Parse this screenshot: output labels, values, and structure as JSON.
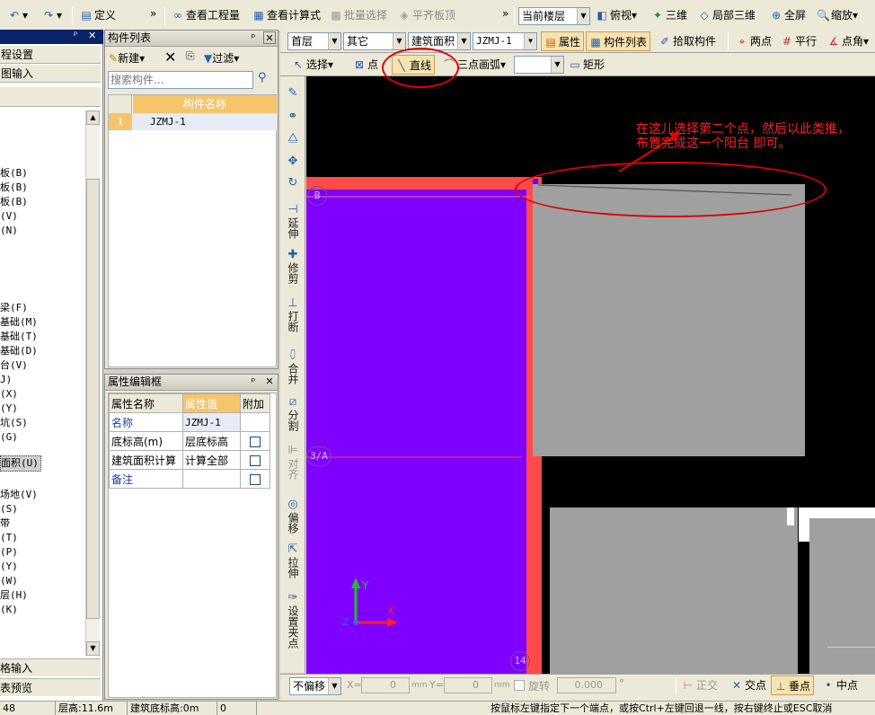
{
  "top_toolbar": {
    "undo_icon": "undo-icon",
    "redo_icon": "redo-icon",
    "define": "定义",
    "view_quantity": "查看工程量",
    "view_formula": "查看计算式",
    "batch_select": "批量选择",
    "flush_slab_top": "平齐板顶",
    "floor_combo": "当前楼层",
    "top_view": "俯视",
    "three_d": "三维",
    "local_3d": "局部三维",
    "fullscreen": "全屏",
    "zoom": "缩放"
  },
  "second_toolbar": {
    "floor": "首层",
    "category": "其它",
    "type": "建筑面积",
    "component": "JZMJ-1",
    "properties": "属性",
    "component_list": "构件列表",
    "pick_component": "拾取构件",
    "two_points": "两点",
    "parallel": "平行",
    "point_angle": "点角"
  },
  "draw_toolbar": {
    "select": "选择",
    "point": "点",
    "line": "直线",
    "arc": "三点画弧",
    "shape_combo": "",
    "rectangle": "矩形"
  },
  "left_panel": {
    "item1": "程设置",
    "item2": "图输入",
    "list": [
      "板(B)",
      "板(B)",
      "板(B)",
      "(V)",
      "(N)",
      "梁(F)",
      "基础(M)",
      "基础(T)",
      "基础(D)",
      "台(V)",
      "J)",
      "(X)",
      "(Y)",
      "坑(S)",
      "(G)",
      "面积(U)",
      "场地(V)",
      "(S)",
      "带",
      "(T)",
      "(P)",
      "(Y)",
      "(W)",
      "层(H)",
      "(K)"
    ],
    "selected_index": 15,
    "bottom1": "格输入",
    "bottom2": "表预览"
  },
  "component_list": {
    "title": "构件列表",
    "new": "新建",
    "filter": "过滤",
    "search_placeholder": "搜索构件...",
    "header": "构件名称",
    "rows": [
      {
        "num": "1",
        "name": "JZMJ-1"
      }
    ]
  },
  "property_panel": {
    "title": "属性编辑框",
    "headers": [
      "属性名称",
      "属性值",
      "附加"
    ],
    "rows": [
      {
        "name": "名称",
        "value": "JZMJ-1",
        "has_check": false
      },
      {
        "name": "底标高(m)",
        "value": "层底标高",
        "has_check": true
      },
      {
        "name": "建筑面积计算",
        "value": "计算全部",
        "has_check": true
      },
      {
        "name": "备注",
        "value": "",
        "has_check": true
      }
    ]
  },
  "vertical_tools": [
    "延伸",
    "修剪",
    "打断",
    "合并",
    "分割",
    "对齐",
    "偏移",
    "拉伸",
    "设置夹点"
  ],
  "canvas": {
    "annotation": "在这儿选择第二个点，然后以此类推，布置完成这一个阳台 即可。",
    "axis_b": "B",
    "axis_3a": "3/A",
    "axis_14": "14",
    "ucs_x": "X",
    "ucs_y": "Y",
    "ucs_z": "Z",
    "colors": {
      "background": "#000000",
      "purple": "#8000ff",
      "red": "#ff4a4a",
      "gray": "#a0a0a0",
      "annotation": "#ff2020"
    }
  },
  "bottom_bar": {
    "offset_mode": "不偏移",
    "x_label": "X=",
    "x_value": "0",
    "y_label": "Y=",
    "y_value": "0",
    "unit": "mm",
    "rotate_label": "旋转",
    "rotate_value": "0.000",
    "degree": "°",
    "ortho": "正交",
    "intersection": "交点",
    "perpendicular": "垂点",
    "midpoint": "中点"
  },
  "status_bar": {
    "left": "48",
    "floor_height": "层高:11.6m",
    "base_elevation": "建筑底标高:0m",
    "count": "0",
    "message": "按鼠标左键指定下一个端点，或按Ctrl+左键回退一线，按右键终止或ESC取消"
  }
}
